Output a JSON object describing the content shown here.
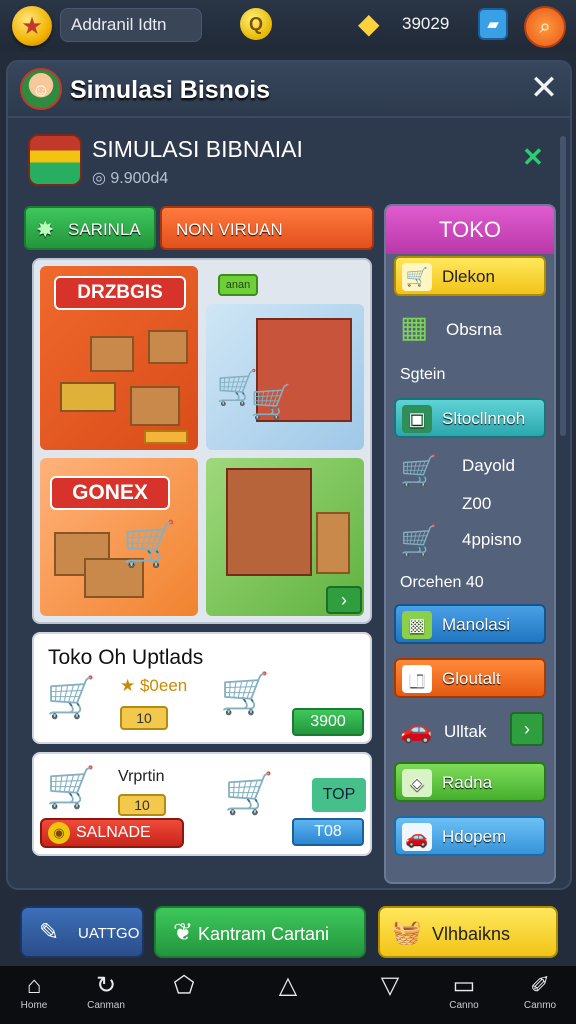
{
  "topbar": {
    "player_name": "Addranil Idtn",
    "currency_amount": "39029"
  },
  "window": {
    "title": "Simulasi Bisnois",
    "store_name": "SIMULASI BIBNAIAI",
    "store_sub": "◎ 9.900d4"
  },
  "tabs": [
    {
      "label": "SARINLA"
    },
    {
      "label": "NON VIRUAN"
    }
  ],
  "tiles": {
    "t1_sign": "DRZBGIS",
    "t1_badge": "anan",
    "t3_sign": "GONEX"
  },
  "offer": {
    "title": "Toko Oh Uptlads",
    "star_text": "★ $0een",
    "pill": "10",
    "price": "3900"
  },
  "offer2": {
    "label": "Vrprtin",
    "pill": "10",
    "button": "SALNADE",
    "top_box": "TOP",
    "blue_pill": "T08"
  },
  "right_panel": {
    "title": "TOKO",
    "items": [
      {
        "label": "Dlekon"
      },
      {
        "label": "Obsrna"
      },
      {
        "label": "Sgtein"
      },
      {
        "label": "Sltocllnnoh"
      },
      {
        "label": "Dayold"
      },
      {
        "label": "Z00"
      },
      {
        "label": "4ppisno"
      },
      {
        "label": "Orcehen 40"
      },
      {
        "label": "Manolasi"
      },
      {
        "label": "Gloutalt"
      },
      {
        "label": "Ulltak"
      },
      {
        "label": "Radna"
      },
      {
        "label": "Hdopem"
      }
    ]
  },
  "bottom_buttons": [
    {
      "label": "UATTGO"
    },
    {
      "label": "Kantram Cartani"
    },
    {
      "label": "Vlhbaikns"
    }
  ],
  "nav": [
    {
      "label": "Home"
    },
    {
      "label": "Canman"
    },
    {
      "label": ""
    },
    {
      "label": ""
    },
    {
      "label": ""
    },
    {
      "label": "Canno"
    },
    {
      "label": "Canmo"
    }
  ]
}
